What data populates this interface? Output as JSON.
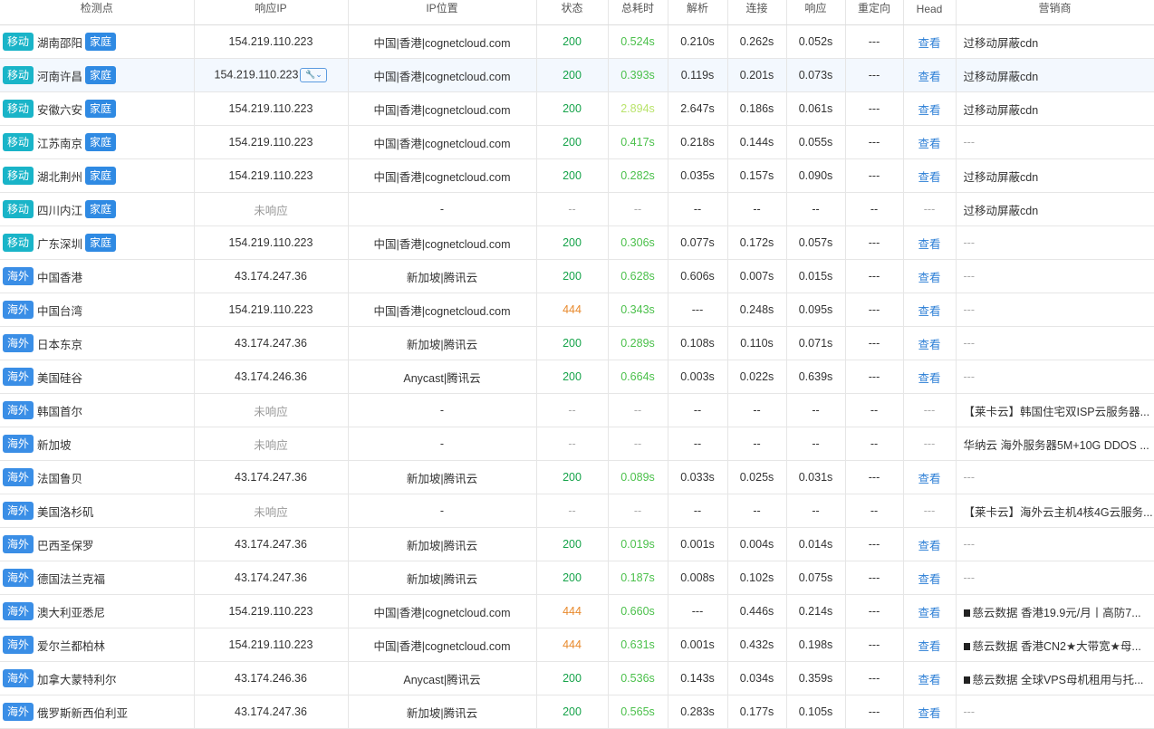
{
  "headers": [
    "检测点",
    "响应IP",
    "IP位置",
    "状态",
    "总耗时",
    "解析",
    "连接",
    "响应",
    "重定向",
    "Head",
    "营销商"
  ],
  "rows": [
    {
      "type": "移动",
      "home": "家庭",
      "loc": "湖南邵阳",
      "ip": "154.219.110.223",
      "ipl": "中国|香港|cognetcloud.com",
      "status": "200",
      "total": "0.524s",
      "dns": "0.210s",
      "conn": "0.262s",
      "resp": "0.052s",
      "redir": "---",
      "head": "查看",
      "msg": "过移动屏蔽cdn"
    },
    {
      "type": "移动",
      "home": "家庭",
      "loc": "河南许昌",
      "ip": "154.219.110.223",
      "ipl": "中国|香港|cognetcloud.com",
      "status": "200",
      "total": "0.393s",
      "dns": "0.119s",
      "conn": "0.201s",
      "resp": "0.073s",
      "redir": "---",
      "head": "查看",
      "msg": "过移动屏蔽cdn",
      "highlight": true
    },
    {
      "type": "移动",
      "home": "家庭",
      "loc": "安徽六安",
      "ip": "154.219.110.223",
      "ipl": "中国|香港|cognetcloud.com",
      "status": "200",
      "total": "2.894s",
      "dns": "2.647s",
      "conn": "0.186s",
      "resp": "0.061s",
      "redir": "---",
      "head": "查看",
      "msg": "过移动屏蔽cdn",
      "slow": true
    },
    {
      "type": "移动",
      "home": "家庭",
      "loc": "江苏南京",
      "ip": "154.219.110.223",
      "ipl": "中国|香港|cognetcloud.com",
      "status": "200",
      "total": "0.417s",
      "dns": "0.218s",
      "conn": "0.144s",
      "resp": "0.055s",
      "redir": "---",
      "head": "查看",
      "msg": "---"
    },
    {
      "type": "移动",
      "home": "家庭",
      "loc": "湖北荆州",
      "ip": "154.219.110.223",
      "ipl": "中国|香港|cognetcloud.com",
      "status": "200",
      "total": "0.282s",
      "dns": "0.035s",
      "conn": "0.157s",
      "resp": "0.090s",
      "redir": "---",
      "head": "查看",
      "msg": "过移动屏蔽cdn"
    },
    {
      "type": "移动",
      "home": "家庭",
      "loc": "四川内江",
      "ip": "未响应",
      "ipl": "-",
      "status": "--",
      "total": "--",
      "dns": "--",
      "conn": "--",
      "resp": "--",
      "redir": "--",
      "head": "---",
      "msg": "过移动屏蔽cdn",
      "noresp": true
    },
    {
      "type": "移动",
      "home": "家庭",
      "loc": "广东深圳",
      "ip": "154.219.110.223",
      "ipl": "中国|香港|cognetcloud.com",
      "status": "200",
      "total": "0.306s",
      "dns": "0.077s",
      "conn": "0.172s",
      "resp": "0.057s",
      "redir": "---",
      "head": "查看",
      "msg": "---"
    },
    {
      "type": "海外",
      "loc": "中国香港",
      "ip": "43.174.247.36",
      "ipl": "新加坡|腾讯云",
      "status": "200",
      "total": "0.628s",
      "dns": "0.606s",
      "conn": "0.007s",
      "resp": "0.015s",
      "redir": "---",
      "head": "查看",
      "msg": "---"
    },
    {
      "type": "海外",
      "loc": "中国台湾",
      "ip": "154.219.110.223",
      "ipl": "中国|香港|cognetcloud.com",
      "status": "444",
      "total": "0.343s",
      "dns": "---",
      "conn": "0.248s",
      "resp": "0.095s",
      "redir": "---",
      "head": "查看",
      "msg": "---"
    },
    {
      "type": "海外",
      "loc": "日本东京",
      "ip": "43.174.247.36",
      "ipl": "新加坡|腾讯云",
      "status": "200",
      "total": "0.289s",
      "dns": "0.108s",
      "conn": "0.110s",
      "resp": "0.071s",
      "redir": "---",
      "head": "查看",
      "msg": "---"
    },
    {
      "type": "海外",
      "loc": "美国硅谷",
      "ip": "43.174.246.36",
      "ipl": "Anycast|腾讯云",
      "status": "200",
      "total": "0.664s",
      "dns": "0.003s",
      "conn": "0.022s",
      "resp": "0.639s",
      "redir": "---",
      "head": "查看",
      "msg": "---"
    },
    {
      "type": "海外",
      "loc": "韩国首尔",
      "ip": "未响应",
      "ipl": "-",
      "status": "--",
      "total": "--",
      "dns": "--",
      "conn": "--",
      "resp": "--",
      "redir": "--",
      "head": "---",
      "msg": "【莱卡云】韩国住宅双ISP云服务器...",
      "noresp": true
    },
    {
      "type": "海外",
      "loc": "新加坡",
      "ip": "未响应",
      "ipl": "-",
      "status": "--",
      "total": "--",
      "dns": "--",
      "conn": "--",
      "resp": "--",
      "redir": "--",
      "head": "---",
      "msg": "华纳云 海外服务器5M+10G DDOS ...",
      "noresp": true
    },
    {
      "type": "海外",
      "loc": "法国鲁贝",
      "ip": "43.174.247.36",
      "ipl": "新加坡|腾讯云",
      "status": "200",
      "total": "0.089s",
      "dns": "0.033s",
      "conn": "0.025s",
      "resp": "0.031s",
      "redir": "---",
      "head": "查看",
      "msg": "---"
    },
    {
      "type": "海外",
      "loc": "美国洛杉矶",
      "ip": "未响应",
      "ipl": "-",
      "status": "--",
      "total": "--",
      "dns": "--",
      "conn": "--",
      "resp": "--",
      "redir": "--",
      "head": "---",
      "msg": "【莱卡云】海外云主机4核4G云服务...",
      "noresp": true
    },
    {
      "type": "海外",
      "loc": "巴西圣保罗",
      "ip": "43.174.247.36",
      "ipl": "新加坡|腾讯云",
      "status": "200",
      "total": "0.019s",
      "dns": "0.001s",
      "conn": "0.004s",
      "resp": "0.014s",
      "redir": "---",
      "head": "查看",
      "msg": "---"
    },
    {
      "type": "海外",
      "loc": "德国法兰克福",
      "ip": "43.174.247.36",
      "ipl": "新加坡|腾讯云",
      "status": "200",
      "total": "0.187s",
      "dns": "0.008s",
      "conn": "0.102s",
      "resp": "0.075s",
      "redir": "---",
      "head": "查看",
      "msg": "---"
    },
    {
      "type": "海外",
      "loc": "澳大利亚悉尼",
      "ip": "154.219.110.223",
      "ipl": "中国|香港|cognetcloud.com",
      "status": "444",
      "total": "0.660s",
      "dns": "---",
      "conn": "0.446s",
      "resp": "0.214s",
      "redir": "---",
      "head": "查看",
      "msg": "慈云数据 香港19.9元/月丨高防7...",
      "sq": true
    },
    {
      "type": "海外",
      "loc": "爱尔兰都柏林",
      "ip": "154.219.110.223",
      "ipl": "中国|香港|cognetcloud.com",
      "status": "444",
      "total": "0.631s",
      "dns": "0.001s",
      "conn": "0.432s",
      "resp": "0.198s",
      "redir": "---",
      "head": "查看",
      "msg": "慈云数据 香港CN2★大带宽★母...",
      "sq": true
    },
    {
      "type": "海外",
      "loc": "加拿大蒙特利尔",
      "ip": "43.174.246.36",
      "ipl": "Anycast|腾讯云",
      "status": "200",
      "total": "0.536s",
      "dns": "0.143s",
      "conn": "0.034s",
      "resp": "0.359s",
      "redir": "---",
      "head": "查看",
      "msg": "慈云数据 全球VPS母机租用与托...",
      "sq": true
    },
    {
      "type": "海外",
      "loc": "俄罗斯新西伯利亚",
      "ip": "43.174.247.36",
      "ipl": "新加坡|腾讯云",
      "status": "200",
      "total": "0.565s",
      "dns": "0.283s",
      "conn": "0.177s",
      "resp": "0.105s",
      "redir": "---",
      "head": "查看",
      "msg": "---"
    }
  ]
}
